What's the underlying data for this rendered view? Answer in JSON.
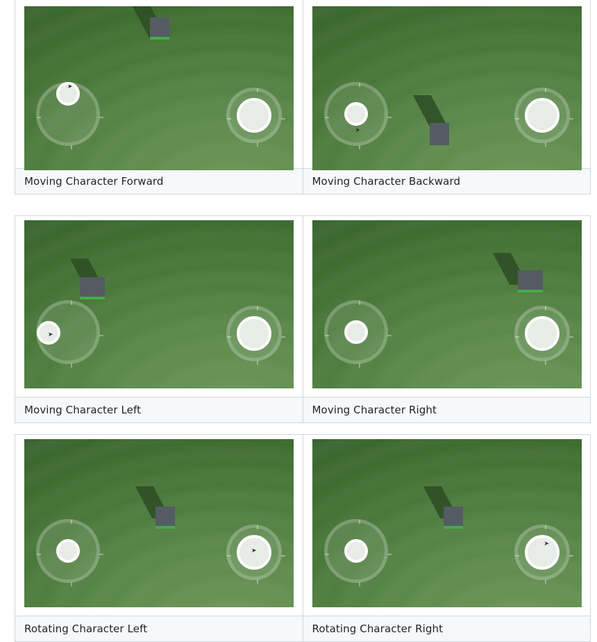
{
  "cells": [
    {
      "caption": "Moving Character Forward",
      "cursor_icon": "pointer-arrow"
    },
    {
      "caption": "Moving Character Backward",
      "cursor_icon": "pointer-arrow"
    },
    {
      "caption": "Moving Character Left",
      "cursor_icon": "pointer-arrow"
    },
    {
      "caption": "Moving Character Right",
      "cursor_icon": "pointer-arrow"
    },
    {
      "caption": "Rotating Character Left",
      "cursor_icon": "pointer-arrow"
    },
    {
      "caption": "Rotating Character Right",
      "cursor_icon": "pointer-arrow"
    }
  ],
  "colors": {
    "ground": "#4c7a3c",
    "cube": "#555b63",
    "cube_edge": "#43ad45",
    "border": "#d0d7de",
    "caption_bg": "#f6f8fa"
  }
}
